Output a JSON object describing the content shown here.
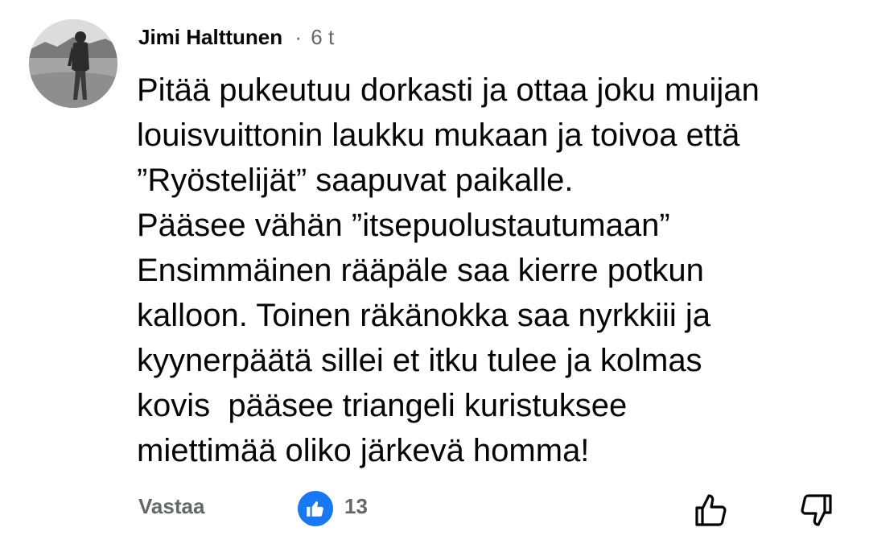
{
  "comment": {
    "author": "Jimi Halttunen",
    "separator": "·",
    "time": "6 t",
    "body_lines": [
      "Pitää pukeutuu dorkasti ja ottaa joku muijan",
      "louisvuittonin laukku mukaan ja toivoa että",
      "”Ryöstelijät” saapuvat paikalle.",
      "Pääsee vähän ”itsepuolustautumaan”",
      "Ensimmäinen rääpäle saa kierre potkun",
      "kalloon. Toinen räkänokka saa nyrkkiii ja",
      "kyynerpäätä sillei et itku tulee ja kolmas",
      "kovis  pääsee triangeli kuristuksee",
      "miettimää oliko järkevä homma!"
    ]
  },
  "footer": {
    "reply_label": "Vastaa",
    "like_count": "13",
    "like_icon": "like-badge-icon",
    "thumb_up_icon": "thumb-up-icon",
    "thumb_down_icon": "thumb-down-icon"
  },
  "colors": {
    "text": "#050505",
    "secondary": "#65676b",
    "like_blue": "#1877f2"
  }
}
